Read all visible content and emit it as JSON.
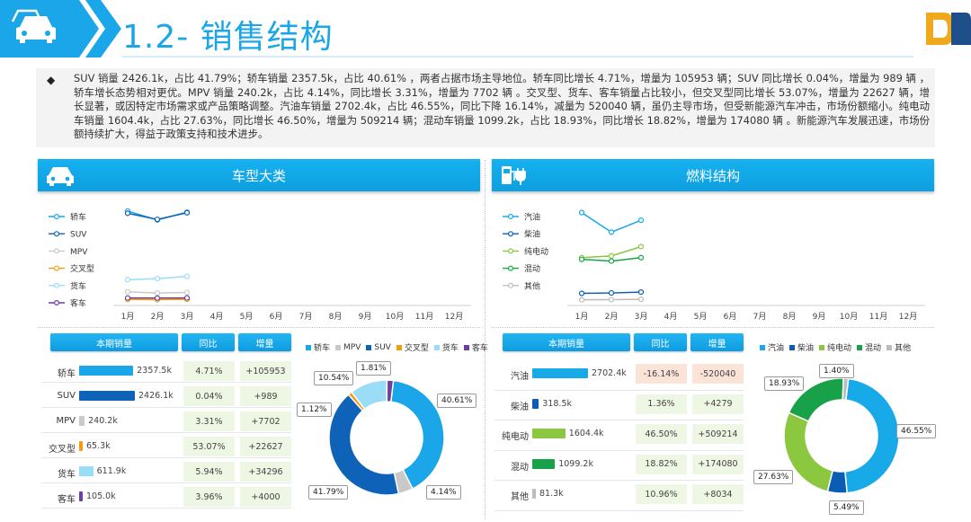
{
  "header": {
    "title": "1.2- 销售结构"
  },
  "intro": {
    "bullet": "◆",
    "text": "SUV 销量 2426.1k，占比 41.79%；轿车销量 2357.5k，占比 40.61% ，两者占据市场主导地位。轿车同比增长 4.71%，增量为 105953 辆；SUV 同比增长 0.04%，增量为 989 辆 ，轿车增长态势相对更优。MPV 销量 240.2k，占比 4.14%，同比增长 3.31%，增量为 7702 辆 。交叉型、货车、客车销量占比较小，但交叉型同比增长 53.07%，增量为 22627 辆，增长显著，或因特定市场需求或产品策略调整。汽油车销量 2702.4k，占比 46.55%，同比下降 16.14%，减量为 520040 辆，虽仍主导市场，但受新能源汽车冲击，市场份额缩小。纯电动车销量 1604.4k，占比 27.63%，同比增长 46.50%，增量为 509214 辆；混动车销量 1099.2k，占比 18.93%，同比增长 18.82%，增量为 174080 辆 。新能源汽车发展迅速，市场份额持续扩大，得益于政策支持和技术进步。"
  },
  "left": {
    "title": "车型大类",
    "months": [
      "1月",
      "2月",
      "3月",
      "4月",
      "5月",
      "6月",
      "7月",
      "8月",
      "9月",
      "10月",
      "11月",
      "12月"
    ],
    "line_legend": [
      "轿车",
      "SUV",
      "MPV",
      "交叉型",
      "货车",
      "客车"
    ],
    "table_headers": [
      "本期销量",
      "同比",
      "增量"
    ],
    "rows": [
      {
        "label": "轿车",
        "value": "2357.5k",
        "yoy": "4.71%",
        "inc": "+105953"
      },
      {
        "label": "SUV",
        "value": "2426.1k",
        "yoy": "0.04%",
        "inc": "+989"
      },
      {
        "label": "MPV",
        "value": "240.2k",
        "yoy": "3.31%",
        "inc": "+7702"
      },
      {
        "label": "交叉型",
        "value": "65.3k",
        "yoy": "53.07%",
        "inc": "+22627"
      },
      {
        "label": "货车",
        "value": "611.9k",
        "yoy": "5.94%",
        "inc": "+34296"
      },
      {
        "label": "客车",
        "value": "105.0k",
        "yoy": "3.96%",
        "inc": "+4000"
      }
    ],
    "donut_legend": [
      "轿车",
      "MPV",
      "SUV",
      "交叉型",
      "货车",
      "客车"
    ],
    "donut_labels": [
      "40.61%",
      "4.14%",
      "41.79%",
      "1.12%",
      "10.54%",
      "1.81%"
    ]
  },
  "right": {
    "title": "燃料结构",
    "months": [
      "1月",
      "2月",
      "3月",
      "4月",
      "5月",
      "6月",
      "7月",
      "8月",
      "9月",
      "10月",
      "11月",
      "12月"
    ],
    "line_legend": [
      "汽油",
      "柴油",
      "纯电动",
      "混动",
      "其他"
    ],
    "table_headers": [
      "本期销量",
      "同比",
      "增量"
    ],
    "rows": [
      {
        "label": "汽油",
        "value": "2702.4k",
        "yoy": "-16.14%",
        "inc": "-520040"
      },
      {
        "label": "柴油",
        "value": "318.5k",
        "yoy": "1.36%",
        "inc": "+4279"
      },
      {
        "label": "纯电动",
        "value": "1604.4k",
        "yoy": "46.50%",
        "inc": "+509214"
      },
      {
        "label": "混动",
        "value": "1099.2k",
        "yoy": "18.82%",
        "inc": "+174080"
      },
      {
        "label": "其他",
        "value": "81.3k",
        "yoy": "10.96%",
        "inc": "+8034"
      }
    ],
    "donut_legend": [
      "汽油",
      "柴油",
      "纯电动",
      "混动",
      "其他"
    ],
    "donut_labels": [
      "46.55%",
      "5.49%",
      "27.63%",
      "18.93%",
      "1.40%"
    ]
  },
  "colors": {
    "accent": "#1aa6e8",
    "car": "#1aa6e8",
    "suv": "#0e63b9",
    "mpv": "#c9c9c9",
    "cross": "#f39c12",
    "truck": "#9bdcf6",
    "bus": "#6f3fa0",
    "petrol": "#17a9e8",
    "diesel": "#0b5cb5",
    "ev": "#8bc83f",
    "hybrid": "#17a24a",
    "other": "#bcbcbc",
    "neg_bg": "#fbe3d8",
    "pos_bg": "#eef6e4"
  },
  "chart_data": [
    {
      "type": "line",
      "x": [
        "1月",
        "2月",
        "3月",
        "4月",
        "5月",
        "6月",
        "7月",
        "8月",
        "9月",
        "10月",
        "11月",
        "12月"
      ],
      "series": [
        {
          "name": "轿车",
          "values": [
            820,
            740,
            810
          ]
        },
        {
          "name": "SUV",
          "values": [
            800,
            745,
            805
          ]
        },
        {
          "name": "MPV",
          "values": [
            90,
            80,
            85
          ]
        },
        {
          "name": "交叉型",
          "values": [
            22,
            20,
            23
          ]
        },
        {
          "name": "货车",
          "values": [
            200,
            210,
            230
          ]
        },
        {
          "name": "客车",
          "values": [
            35,
            34,
            36
          ]
        }
      ]
    },
    {
      "type": "pie",
      "categories": [
        "轿车",
        "MPV",
        "SUV",
        "交叉型",
        "货车",
        "客车"
      ],
      "values": [
        40.61,
        4.14,
        41.79,
        1.12,
        10.54,
        1.81
      ]
    },
    {
      "type": "line",
      "x": [
        "1月",
        "2月",
        "3月",
        "4月",
        "5月",
        "6月",
        "7月",
        "8月",
        "9月",
        "10月",
        "11月",
        "12月"
      ],
      "series": [
        {
          "name": "汽油",
          "values": [
            1050,
            820,
            960
          ]
        },
        {
          "name": "柴油",
          "values": [
            100,
            105,
            115
          ]
        },
        {
          "name": "纯电动",
          "values": [
            520,
            540,
            650
          ]
        },
        {
          "name": "混动",
          "values": [
            500,
            480,
            520
          ]
        },
        {
          "name": "其他",
          "values": [
            25,
            27,
            30
          ]
        }
      ]
    },
    {
      "type": "pie",
      "categories": [
        "汽油",
        "柴油",
        "纯电动",
        "混动",
        "其他"
      ],
      "values": [
        46.55,
        5.49,
        27.63,
        18.93,
        1.4
      ]
    }
  ]
}
